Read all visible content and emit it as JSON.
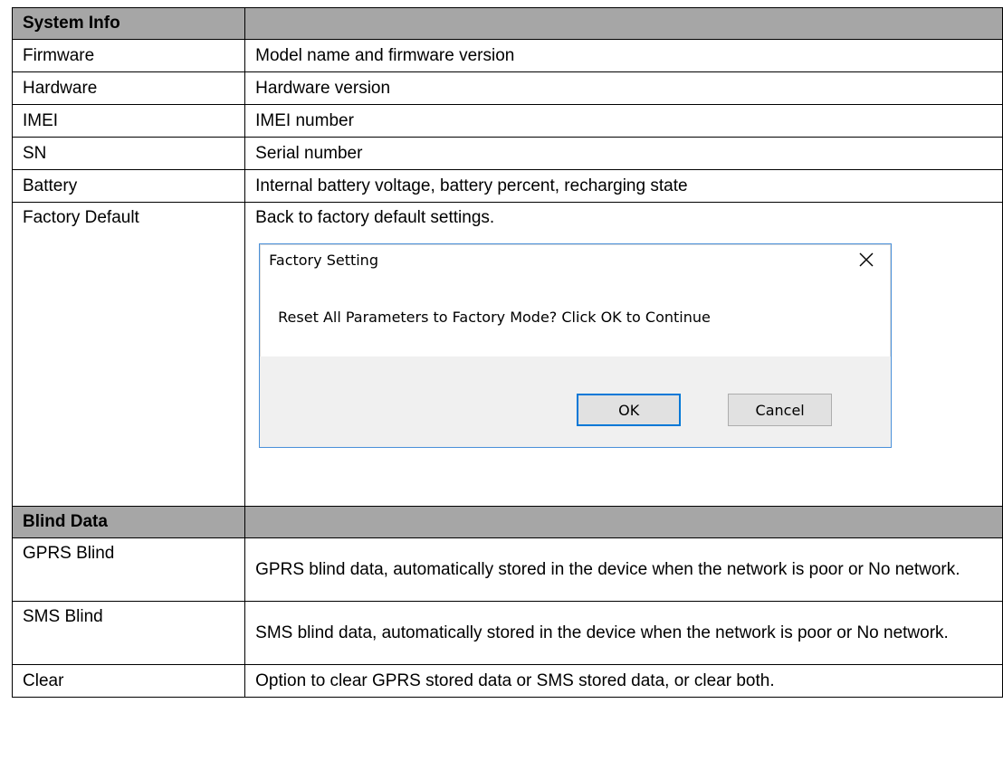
{
  "system_info": {
    "heading": "System Info",
    "rows": [
      {
        "label": "Firmware",
        "desc": "Model name and firmware version"
      },
      {
        "label": "Hardware",
        "desc": "Hardware version"
      },
      {
        "label": "IMEI",
        "desc": "IMEI number"
      },
      {
        "label": "SN",
        "desc": "Serial number"
      },
      {
        "label": "Battery",
        "desc": "Internal battery voltage, battery percent, recharging state"
      },
      {
        "label": "Factory Default",
        "desc": "Back to factory default settings."
      }
    ]
  },
  "dialog": {
    "title": "Factory Setting",
    "close_icon": "close-icon",
    "message": "Reset All Parameters to Factory Mode? Click OK to Continue",
    "ok_label": "OK",
    "cancel_label": "Cancel"
  },
  "blind_data": {
    "heading": "Blind Data",
    "rows": [
      {
        "label": "GPRS Blind",
        "desc": "GPRS blind data, automatically stored in the device when the network is poor or No network."
      },
      {
        "label": "SMS Blind",
        "desc": "SMS blind data, automatically stored in the device when the network is poor or No network."
      },
      {
        "label": "Clear",
        "desc": "Option to clear GPRS stored data or SMS stored data, or clear both."
      }
    ]
  },
  "colors": {
    "section_header_bg": "#a6a6a6",
    "dialog_border": "#4a90d9",
    "dialog_footer_bg": "#f0f0f0"
  }
}
